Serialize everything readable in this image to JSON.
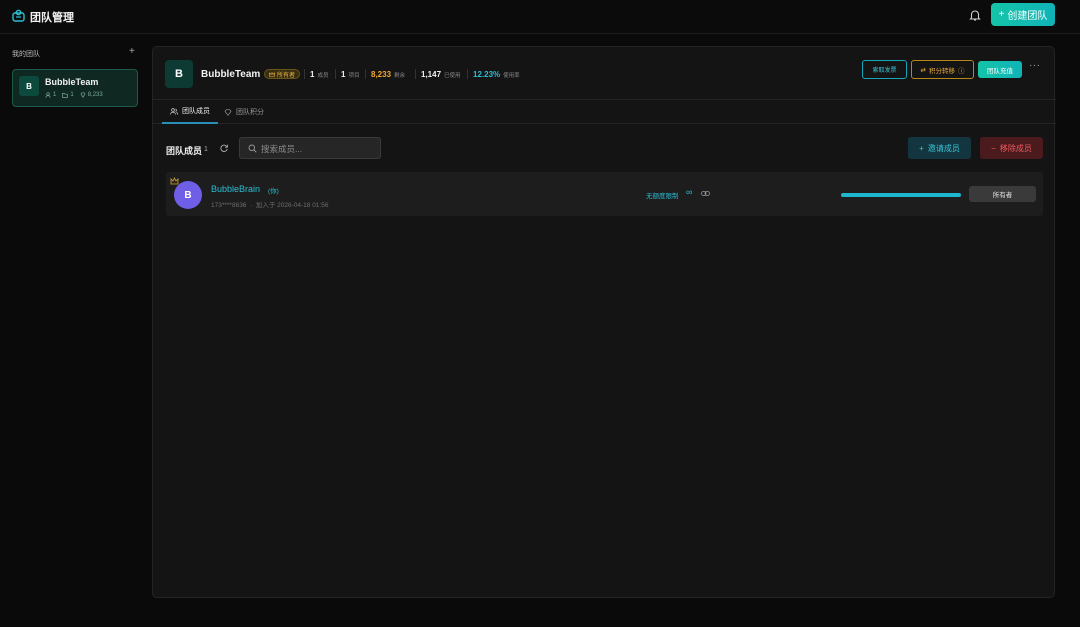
{
  "app": {
    "title": "团队管理",
    "create_team_label": "创建团队"
  },
  "sidebar": {
    "title": "我的团队",
    "teams": [
      {
        "initial": "B",
        "name": "BubbleTeam",
        "members": "1",
        "projects": "1",
        "credits": "8,233"
      }
    ]
  },
  "team": {
    "initial": "B",
    "name": "BubbleTeam",
    "role_badge": "所有者",
    "stats": [
      {
        "value": "1",
        "label": "成员",
        "color": "#f2f2f2"
      },
      {
        "value": "1",
        "label": "项目",
        "color": "#f2f2f2"
      },
      {
        "value": "8,233",
        "label": "剩余",
        "color": "#f0a830"
      },
      {
        "value": "1,147",
        "label": "已使用",
        "color": "#f2f2f2"
      },
      {
        "value": "12.23%",
        "label": "使用率",
        "color": "#2bbfd4"
      }
    ],
    "actions": {
      "invoice": "索取发票",
      "transfer": "积分转移",
      "recharge": "团队充值",
      "more": "···"
    }
  },
  "tabs": [
    {
      "label": "团队成员",
      "active": true
    },
    {
      "label": "团队积分",
      "active": false
    }
  ],
  "members_section": {
    "label": "团队成员",
    "count": "1",
    "search_placeholder": "搜索成员...",
    "invite_label": "邀请成员",
    "remove_label": "移除成员"
  },
  "members": [
    {
      "initial": "B",
      "name": "BubbleBrain",
      "you_tag": "(你)",
      "phone": "173****8636",
      "joined": "加入于 2026-04-18 01:56",
      "quota": "无额度限制",
      "quota_symbol": "∞",
      "usage_fraction": 1.0,
      "role": "所有者"
    }
  ],
  "colors": {
    "accent": "#14c4a8",
    "cyan": "#2bbfd4",
    "warning": "#e8a93a",
    "danger": "#ef5b62"
  }
}
